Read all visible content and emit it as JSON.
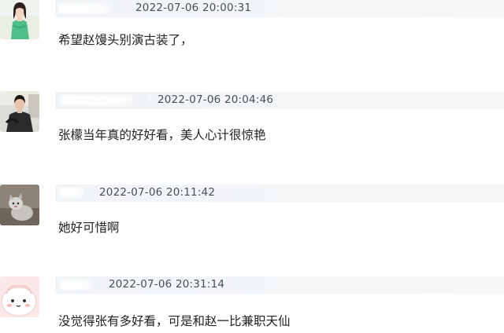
{
  "comments": [
    {
      "avatar_icon": "avatar-woman-green-dress",
      "timestamp": "2022-07-06 20:00:31",
      "text": "希望赵馒头别演古装了，"
    },
    {
      "avatar_icon": "avatar-woman-dark-outfit",
      "timestamp": "2022-07-06 20:04:46",
      "text": "张檬当年真的好好看，美人心计很惊艳"
    },
    {
      "avatar_icon": "avatar-cat-gray",
      "timestamp": "2022-07-06 20:11:42",
      "text": "她好可惜啊"
    },
    {
      "avatar_icon": "avatar-cartoon-dumpling",
      "timestamp": "2022-07-06 20:31:14",
      "text": "没觉得张有多好看，可是和赵一比兼职天仙"
    }
  ]
}
